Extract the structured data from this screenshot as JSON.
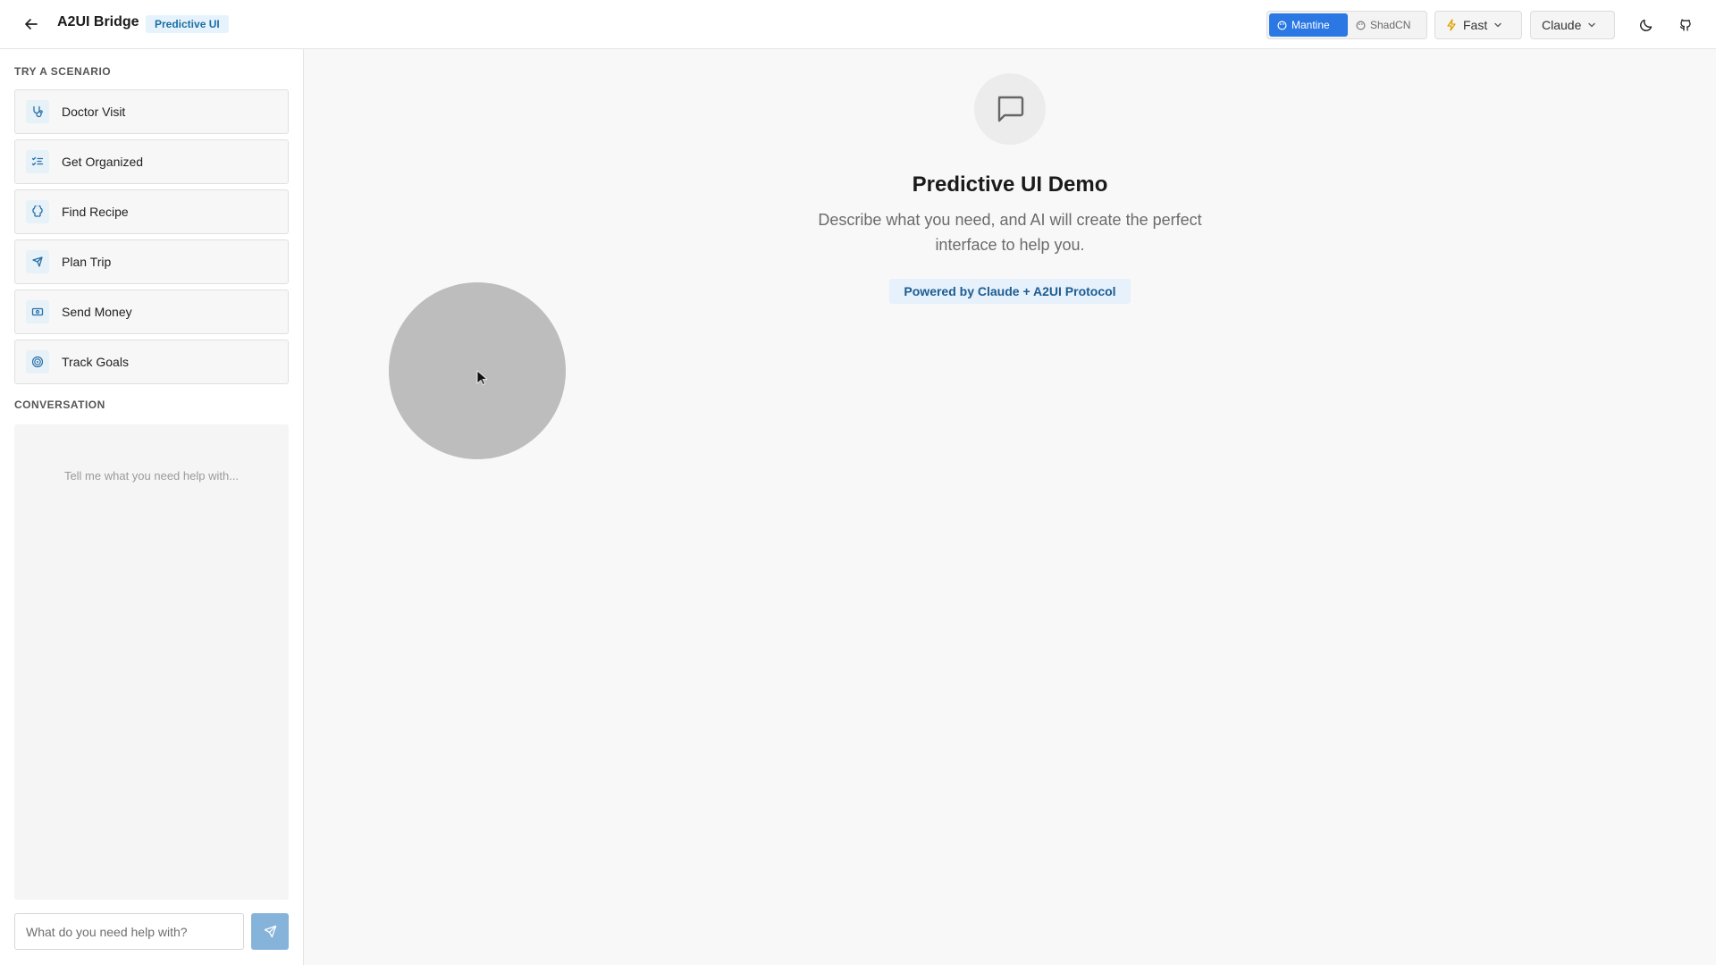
{
  "header": {
    "title": "A2UI Bridge",
    "badge": "Predictive UI",
    "ui_libraries": [
      {
        "label": "Mantine",
        "active": true
      },
      {
        "label": "ShadCN",
        "active": false
      }
    ],
    "speed_select": {
      "value": "Fast",
      "icon": "lightning-icon"
    },
    "model_select": {
      "value": "Claude"
    }
  },
  "sidebar": {
    "scenarios_label": "TRY A SCENARIO",
    "scenarios": [
      {
        "label": "Doctor Visit",
        "icon": "stethoscope-icon"
      },
      {
        "label": "Get Organized",
        "icon": "checklist-icon"
      },
      {
        "label": "Find Recipe",
        "icon": "chef-hat-icon"
      },
      {
        "label": "Plan Trip",
        "icon": "plane-icon"
      },
      {
        "label": "Send Money",
        "icon": "cash-icon"
      },
      {
        "label": "Track Goals",
        "icon": "target-icon"
      }
    ],
    "conversation_label": "CONVERSATION",
    "conversation_empty": "Tell me what you need help with...",
    "input_placeholder": "What do you need help with?"
  },
  "main": {
    "title": "Predictive UI Demo",
    "description": "Describe what you need, and AI will create the perfect interface to help you.",
    "powered_by": "Powered by Claude + A2UI Protocol"
  },
  "colors": {
    "accent": "#2b78e4",
    "badge_bg": "#e7f3fc",
    "badge_text": "#1c6ea4",
    "send_button": "#86b3d9"
  }
}
